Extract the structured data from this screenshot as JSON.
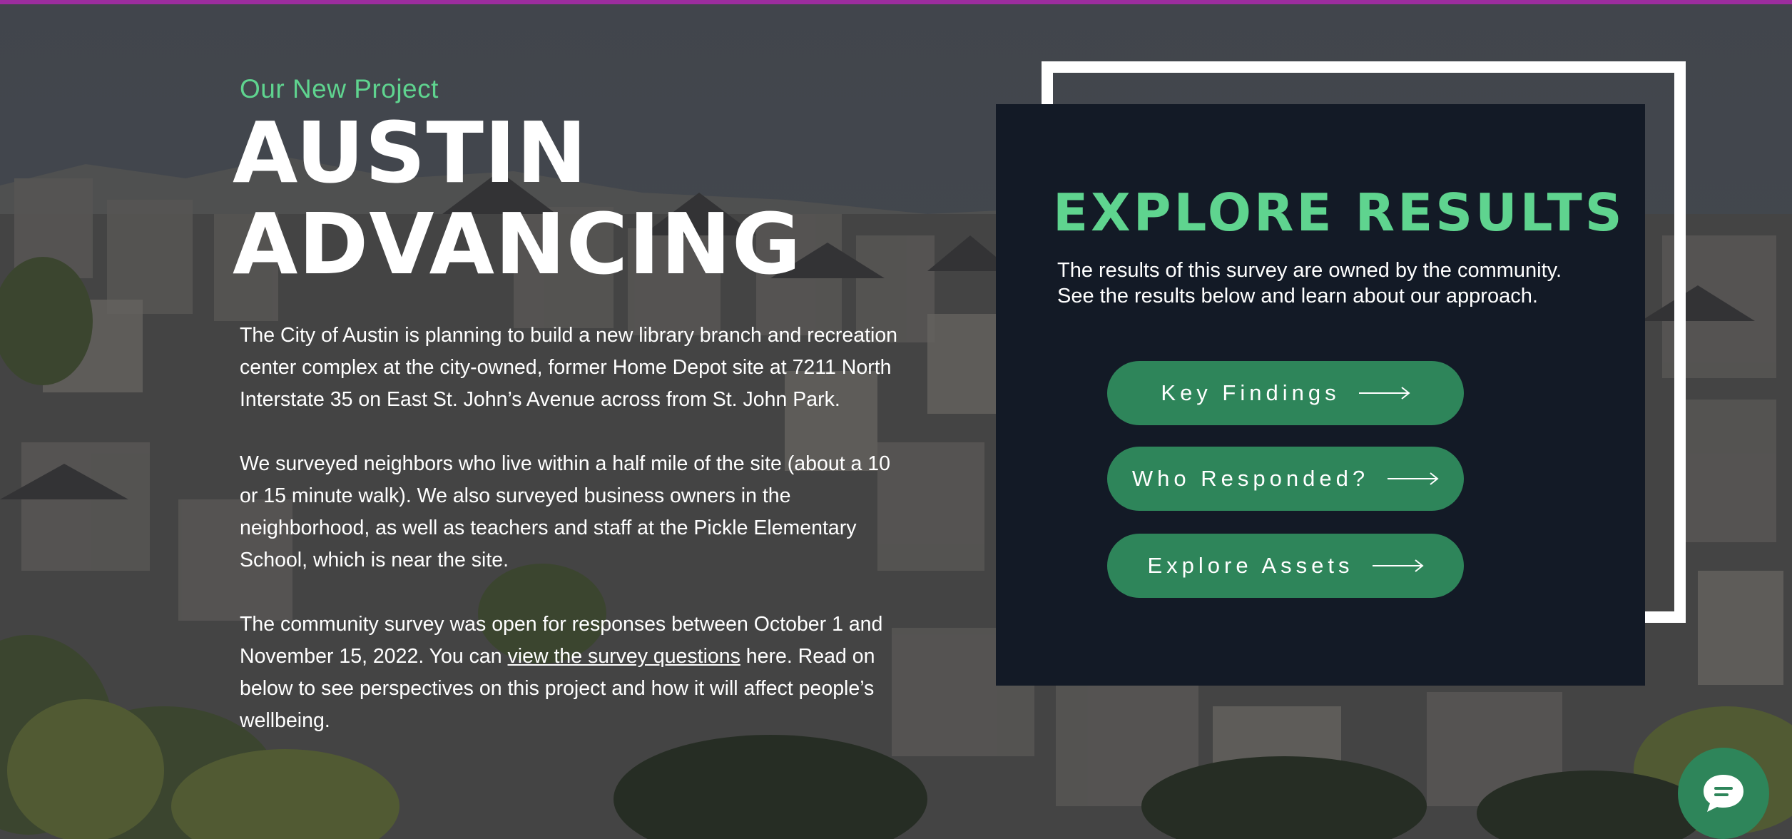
{
  "hero": {
    "eyebrow": "Our New Project",
    "headline_line1": "AUSTIN",
    "headline_line2": "ADVANCING",
    "paragraph1": "The City of Austin is planning to build a new library branch and recreation center complex at the city-owned, former Home Depot site at 7211 North Interstate 35 on East St. John’s Avenue across from St. John Park.",
    "paragraph2": "We surveyed neighbors who live within a half mile of the site (about a 10 or 15 minute walk). We also surveyed business owners in the neighborhood, as well as teachers and staff at the Pickle Elementary School, which is near the site.",
    "paragraph3_before": "The community survey was open for responses between October 1 and November 15, 2022. You can ",
    "paragraph3_link": "view the survey questions",
    "paragraph3_after": " here. Read on below to see perspectives on this project and how it will affect people’s wellbeing."
  },
  "results_panel": {
    "title": "EXPLORE RESULTS",
    "text_line1": "The results of this survey are owned by the community.",
    "text_line2": "See the results below and learn about our approach.",
    "buttons": [
      {
        "label": "Key Findings",
        "icon": "arrow-right-icon"
      },
      {
        "label": "Who Responded?",
        "icon": "arrow-right-icon"
      },
      {
        "label": "Explore Assets",
        "icon": "arrow-right-icon"
      }
    ]
  },
  "chat_widget": {
    "icon": "chat-bubble-icon"
  },
  "colors": {
    "accent_green": "#5fd48f",
    "button_green": "#2e855a",
    "panel_navy": "#131a26",
    "top_bar": "#9c2d9e"
  }
}
